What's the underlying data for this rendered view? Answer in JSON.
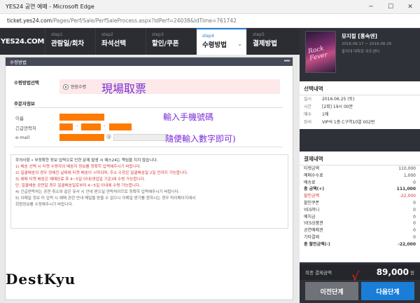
{
  "window": {
    "title": "YES24 공연 예매 - Microsoft Edge",
    "controls": [
      "─",
      "☐",
      "✕"
    ]
  },
  "url": {
    "host": "ticket.yes24.com",
    "path": "/Pages/Perf/Sale/PerfSaleProcess.aspx?IdPerf=24038&IdTime=761742"
  },
  "nav": {
    "logo": "YES24.COM",
    "steps": [
      {
        "num": "step1",
        "label": "관람일/회차"
      },
      {
        "num": "step2",
        "label": "좌석선택"
      },
      {
        "num": "step3",
        "label": "할인/쿠폰"
      },
      {
        "num": "step4",
        "label": "수령방법"
      },
      {
        "num": "step5",
        "label": "결제방법"
      }
    ]
  },
  "panel": {
    "header": "수령방법",
    "header_arrows": "▸▸▸▸",
    "receive_method_label": "수령방법선택",
    "receive_option": "현장수령",
    "annotation_pickup": "現場取票",
    "orderer_label": "주문자정보",
    "name_label": "이름",
    "phone_label": "긴급연락처",
    "email_label": "e-mail",
    "annotation_phone": "輸入手機號碼",
    "annotation_random": "隨便輸入數字即可)",
    "notice": [
      {
        "text": "주의사항 • 부정확한 정보 입력으로 인한 문제 발생 시 예스24는 책임을 지지 않습니다.",
        "style": "hd"
      },
      {
        "text": "1) 배송 선택 시 티켓 수령자의 배송자 정보를 정확히 입력해주시기 바랍니다.",
        "style": "red"
      },
      {
        "text": "2) 일괄배송의 경우 정해진 날짜에 티켓 배송이 시작되며, 주소 수정은 일괄배송일 2일 전까지 가능합니다.",
        "style": "red"
      },
      {
        "text": "3) 예매 티켓 배송은 예매완료 후 4~5일 이내(영업일 기준)에 수령 가능합니다.",
        "style": "red"
      },
      {
        "text": "    단, 일괄배송 공연일 경우 일괄배송일로부터 4~5일 이내에 수령 가능합니다.",
        "style": "red"
      },
      {
        "text": "4) 긴급연락처는 공연 취소와 같은 유사 시 안내 받으실 연락처이므로 정확히 입력해주시기 바랍니다.",
        "style": ""
      },
      {
        "text": "5) 이메일 정보 미 입력 시 예매 관련 안내 메일을 받을 수 없으니 이메일 받기를 원하시는 경우 마이페이지에서",
        "style": ""
      },
      {
        "text": "    회원정보를 수정해주시기 바랍니다.",
        "style": ""
      }
    ]
  },
  "summary": {
    "show_title": "뮤지컬 [홍속엔]",
    "show_dates": "2016.06.17 ~ 2016.08.28",
    "show_venue": "홍익대 대학로 아트센터",
    "poster_text": "Rock Fever",
    "selection_title": "선택내역",
    "selection": [
      {
        "k": "일시",
        "v": "2016.06.25 (토)"
      },
      {
        "k": "시간",
        "v": "[2회] 19시 00분"
      },
      {
        "k": "매수",
        "v": "1매"
      },
      {
        "k": "좌석",
        "v": "VIP석 1층 C구역10열 002번"
      }
    ],
    "payment_title": "결제내역",
    "payment": [
      {
        "k": "티켓금액",
        "v": "110,000",
        "s": ""
      },
      {
        "k": "예매수수료",
        "v": "1,000",
        "s": ""
      },
      {
        "k": "배송료",
        "v": "0",
        "s": ""
      },
      {
        "k": "총 금액(+)",
        "v": "111,000",
        "s": "sum"
      },
      {
        "k": "할인금액",
        "v": "-22,000",
        "s": "red"
      },
      {
        "k": "할인쿠폰",
        "v": "0",
        "s": ""
      },
      {
        "k": "YES머니",
        "v": "0",
        "s": ""
      },
      {
        "k": "예치금",
        "v": "0",
        "s": ""
      },
      {
        "k": "YES상품권",
        "v": "0",
        "s": ""
      },
      {
        "k": "공연예매권",
        "v": "0",
        "s": ""
      },
      {
        "k": "기타결제",
        "v": "0",
        "s": ""
      },
      {
        "k": "총 할인금액(-)",
        "v": "-22,000",
        "s": "sum"
      }
    ],
    "final_label": "최종 결제금액",
    "final_amount": "89,000",
    "final_unit": "원",
    "prev_button": "이전단계",
    "next_button": "다음단계"
  },
  "overlay": {
    "watermark": "DestKyu",
    "checkmark": "√"
  },
  "colors": {
    "accent": "#1a7ed8",
    "redacted": "#ff7a00",
    "annotation": "#7a2fd8",
    "nav_bg": "#2b2d33"
  }
}
